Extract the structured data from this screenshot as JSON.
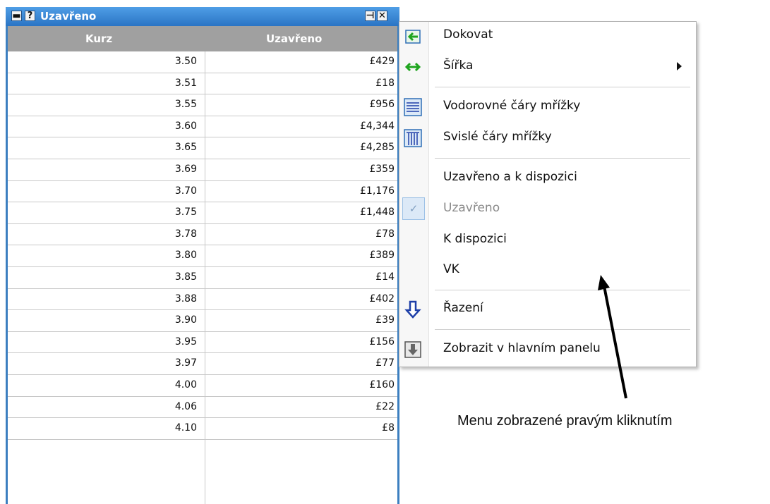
{
  "panel": {
    "title": "Uzavřeno",
    "minimize_glyph": "▬",
    "help_glyph": "?",
    "pin_glyph": "⊣",
    "close_glyph": "✕",
    "columns": [
      "Kurz",
      "Uzavřeno"
    ],
    "rows": [
      [
        "3.50",
        "£429"
      ],
      [
        "3.51",
        "£18"
      ],
      [
        "3.55",
        "£956"
      ],
      [
        "3.60",
        "£4,344"
      ],
      [
        "3.65",
        "£4,285"
      ],
      [
        "3.69",
        "£359"
      ],
      [
        "3.70",
        "£1,176"
      ],
      [
        "3.75",
        "£1,448"
      ],
      [
        "3.78",
        "£78"
      ],
      [
        "3.80",
        "£389"
      ],
      [
        "3.85",
        "£14"
      ],
      [
        "3.88",
        "£402"
      ],
      [
        "3.90",
        "£39"
      ],
      [
        "3.95",
        "£156"
      ],
      [
        "3.97",
        "£77"
      ],
      [
        "4.00",
        "£160"
      ],
      [
        "4.06",
        "£22"
      ],
      [
        "4.10",
        "£8"
      ]
    ]
  },
  "menu": {
    "items": {
      "dock": "Dokovat",
      "width": "Šířka",
      "horizontal_grid": "Vodorovné čáry mřížky",
      "vertical_grid": "Svislé čáry mřížky",
      "matched_and_available": "Uzavřeno a k dispozici",
      "matched": "Uzavřeno",
      "available": "K dispozici",
      "vk": "VK",
      "sort": "Řazení",
      "show_in_main_panel": "Zobrazit v hlavním panelu"
    },
    "check_glyph": "✓"
  },
  "caption": "Menu zobrazené pravým kliknutím",
  "colors": {
    "titlebar": "#2a74c4",
    "header": "#a0a0a0",
    "accent_green": "#1fa51f",
    "accent_blue": "#1e3fa8"
  }
}
